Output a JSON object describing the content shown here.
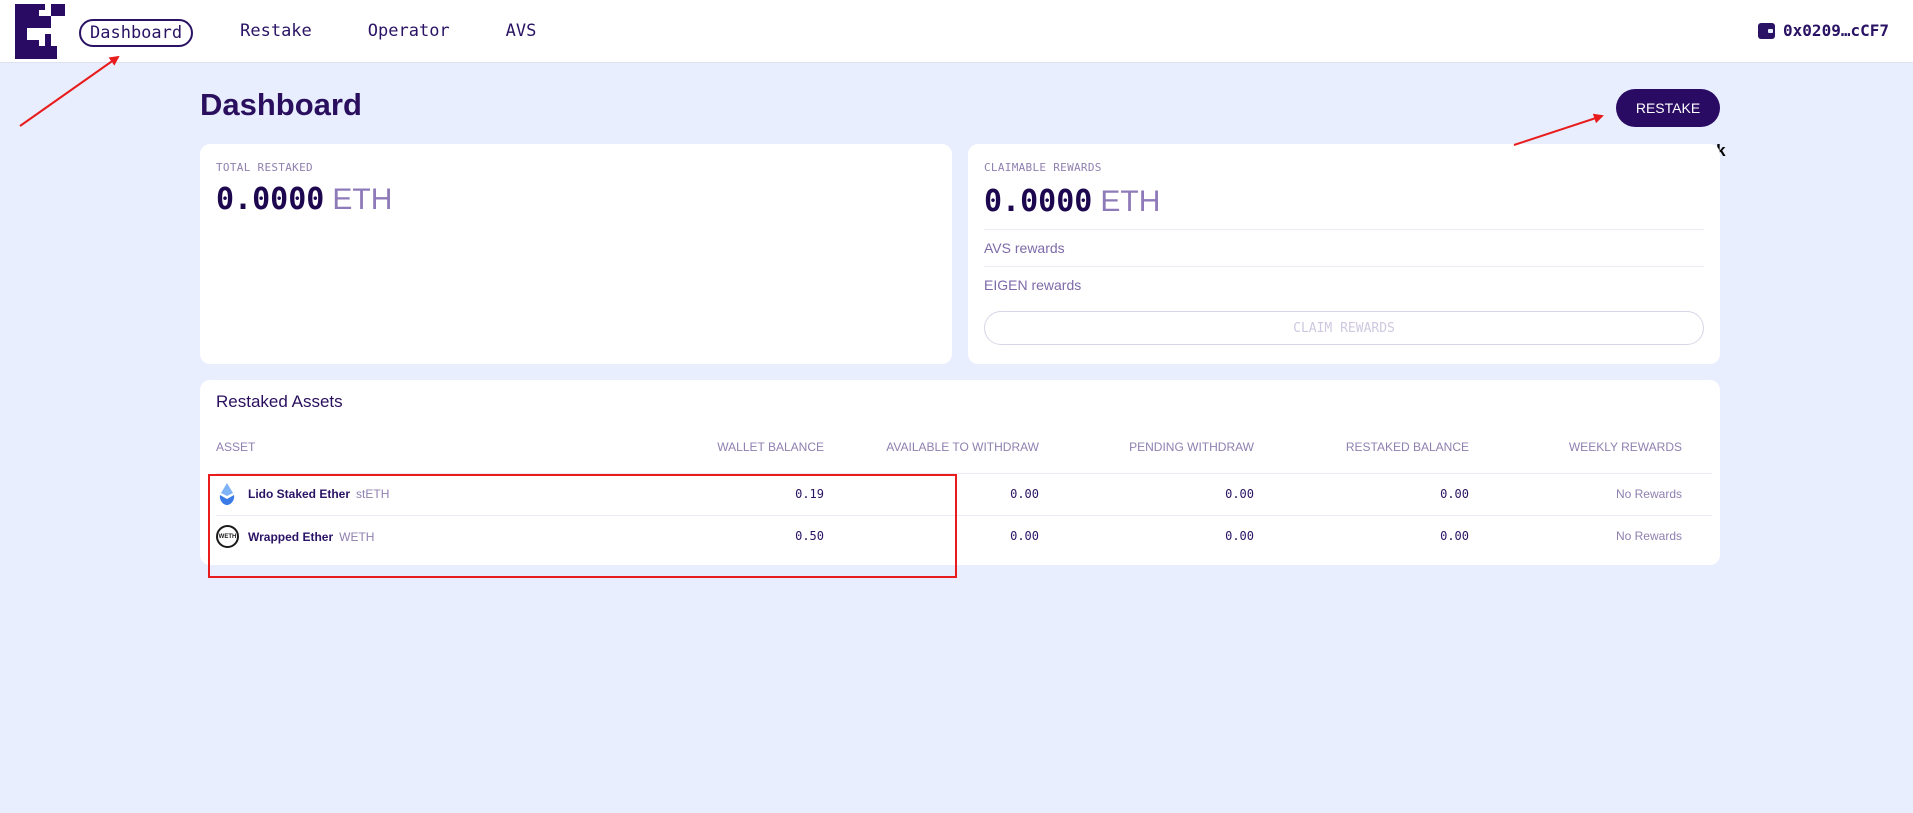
{
  "nav": {
    "items": [
      {
        "label": "Dashboard",
        "active": true
      },
      {
        "label": "Restake",
        "active": false
      },
      {
        "label": "Operator",
        "active": false
      },
      {
        "label": "AVS",
        "active": false
      }
    ],
    "wallet_address": "0x0209…cCF7"
  },
  "page": {
    "title": "Dashboard",
    "restake_button": "RESTAKE",
    "annotation": "Click"
  },
  "total_restaked": {
    "label": "TOTAL RESTAKED",
    "value": "0.0000",
    "unit": "ETH"
  },
  "claimable": {
    "label": "CLAIMABLE REWARDS",
    "value": "0.0000",
    "unit": "ETH",
    "rows": [
      "AVS rewards",
      "EIGEN rewards"
    ],
    "claim_button": "CLAIM REWARDS"
  },
  "assets": {
    "title": "Restaked Assets",
    "columns": [
      "ASSET",
      "WALLET BALANCE",
      "AVAILABLE TO WITHDRAW",
      "PENDING WITHDRAW",
      "RESTAKED BALANCE",
      "WEEKLY REWARDS"
    ],
    "rows": [
      {
        "name": "Lido Staked Ether",
        "symbol": "stETH",
        "icon": "steth-icon",
        "wallet": "0.19",
        "available": "0.00",
        "pending": "0.00",
        "restaked": "0.00",
        "weekly": "No Rewards"
      },
      {
        "name": "Wrapped Ether",
        "symbol": "WETH",
        "icon": "weth-icon",
        "icon_text": "WETH",
        "wallet": "0.50",
        "available": "0.00",
        "pending": "0.00",
        "restaked": "0.00",
        "weekly": "No Rewards"
      }
    ]
  },
  "colors": {
    "background": "#e8eefd",
    "primary": "#2a0b63",
    "muted": "#8f80b0",
    "annotation_red": "#e81c1c"
  }
}
